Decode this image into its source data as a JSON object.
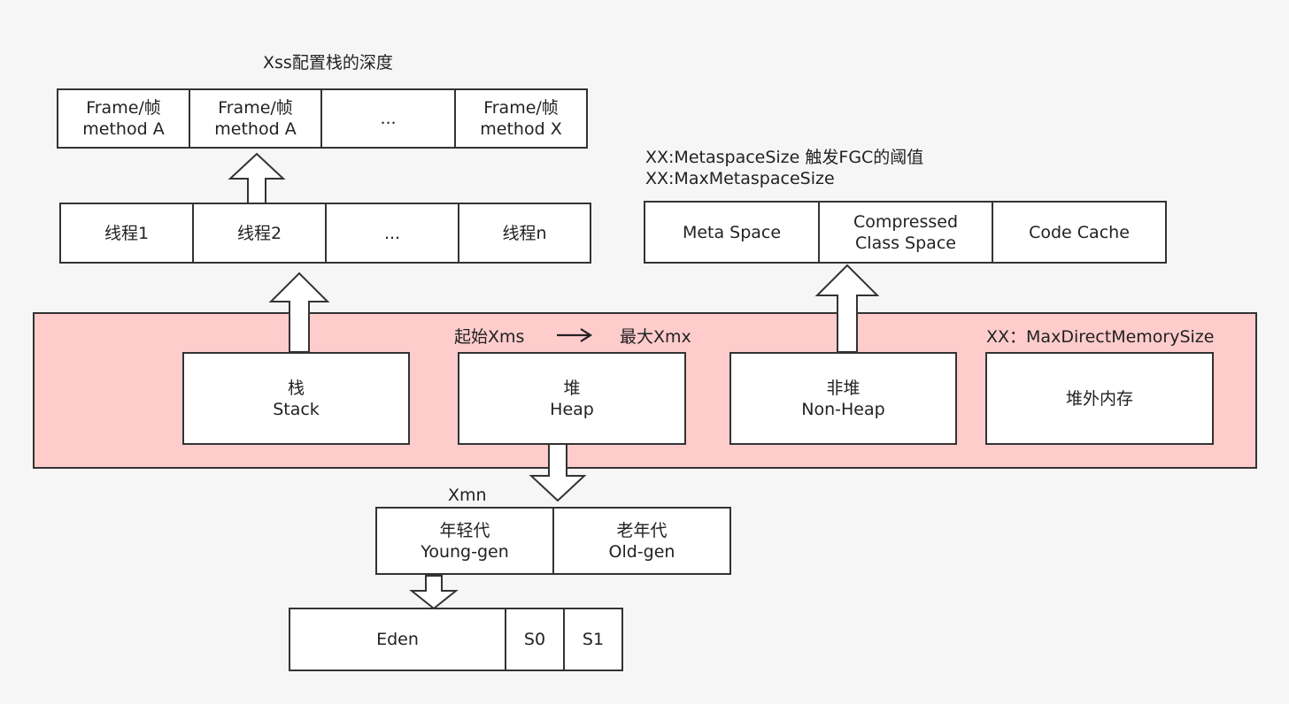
{
  "stack_depth_label": "Xss配置栈的深度",
  "frames": [
    {
      "line1": "Frame/帧",
      "line2": "method A"
    },
    {
      "line1": "Frame/帧",
      "line2": "method A"
    },
    {
      "line1": "...",
      "line2": ""
    },
    {
      "line1": "Frame/帧",
      "line2": "method X"
    }
  ],
  "threads": [
    "线程1",
    "线程2",
    "...",
    "线程n"
  ],
  "metaspace_labels": {
    "line1": "XX:MetaspaceSize 触发FGC的阈值",
    "line2": "XX:MaxMetaspaceSize"
  },
  "nonheap_parts": [
    {
      "line1": "Meta Space",
      "line2": ""
    },
    {
      "line1": "Compressed",
      "line2": "Class Space"
    },
    {
      "line1": "Code Cache",
      "line2": ""
    }
  ],
  "heap_size": {
    "start": "起始Xms",
    "max": "最大Xmx"
  },
  "direct_memory_label": "XX：MaxDirectMemorySize",
  "memory_areas": [
    {
      "line1": "栈",
      "line2": "Stack"
    },
    {
      "line1": "堆",
      "line2": "Heap"
    },
    {
      "line1": "非堆",
      "line2": "Non-Heap"
    },
    {
      "line1": "堆外内存",
      "line2": ""
    }
  ],
  "xmn_label": "Xmn",
  "generations": [
    {
      "line1": "年轻代",
      "line2": "Young-gen"
    },
    {
      "line1": "老年代",
      "line2": "Old-gen"
    }
  ],
  "young_spaces": [
    "Eden",
    "S0",
    "S1"
  ]
}
